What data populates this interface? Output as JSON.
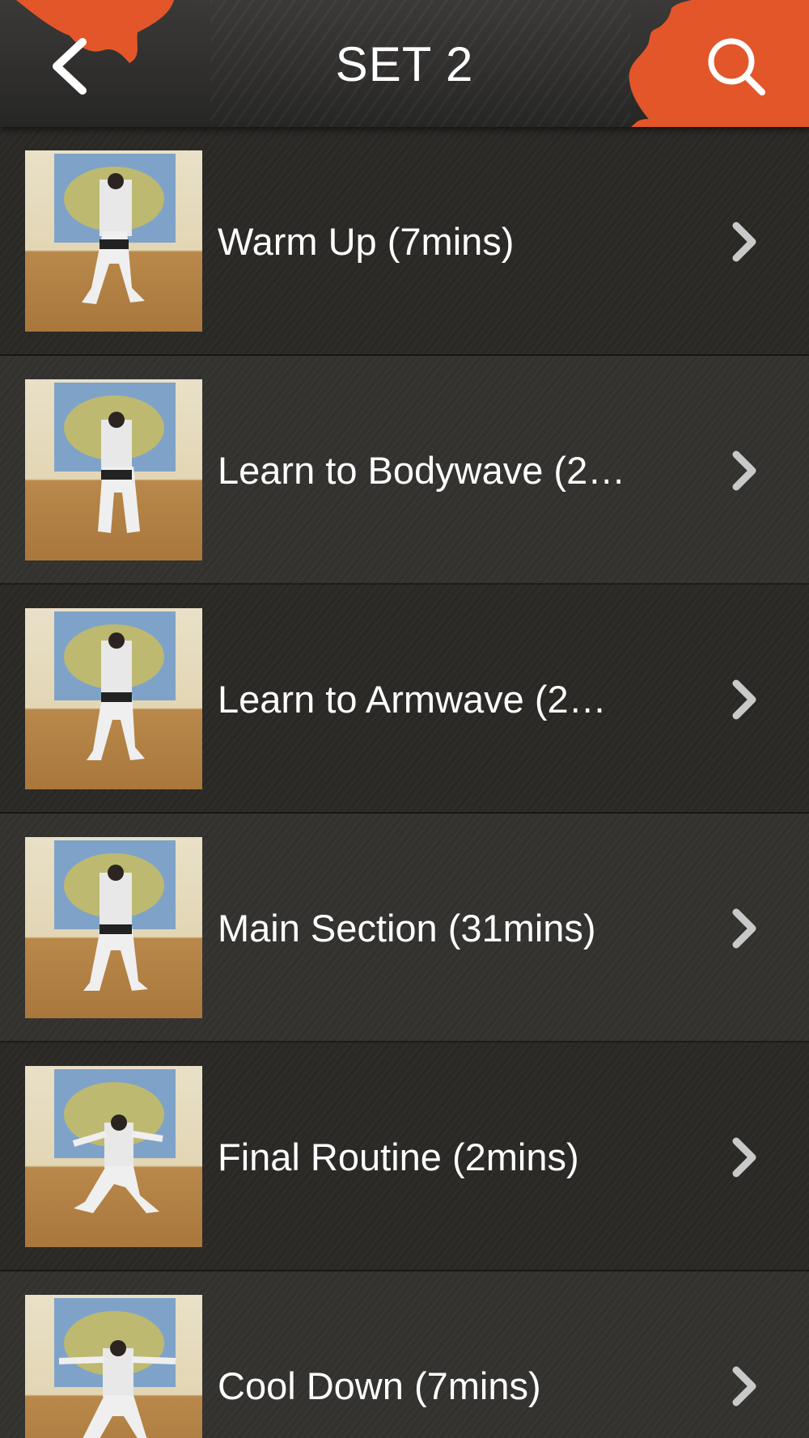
{
  "header": {
    "title": "SET 2",
    "back_icon": "chevron-left-icon",
    "search_icon": "search-icon",
    "accent_color": "#e2562a"
  },
  "list": {
    "items": [
      {
        "label": "Warm Up (7mins)",
        "thumbnail": "dancer-thumbnail",
        "chevron_icon": "chevron-right-icon"
      },
      {
        "label": "Learn to Bodywave (2…",
        "thumbnail": "dancer-thumbnail",
        "chevron_icon": "chevron-right-icon"
      },
      {
        "label": "Learn to Armwave (2…",
        "thumbnail": "dancer-thumbnail",
        "chevron_icon": "chevron-right-icon"
      },
      {
        "label": "Main Section (31mins)",
        "thumbnail": "dancer-thumbnail",
        "chevron_icon": "chevron-right-icon"
      },
      {
        "label": "Final Routine (2mins)",
        "thumbnail": "dancer-thumbnail",
        "chevron_icon": "chevron-right-icon"
      },
      {
        "label": "Cool Down (7mins)",
        "thumbnail": "dancer-thumbnail",
        "chevron_icon": "chevron-right-icon"
      }
    ]
  }
}
